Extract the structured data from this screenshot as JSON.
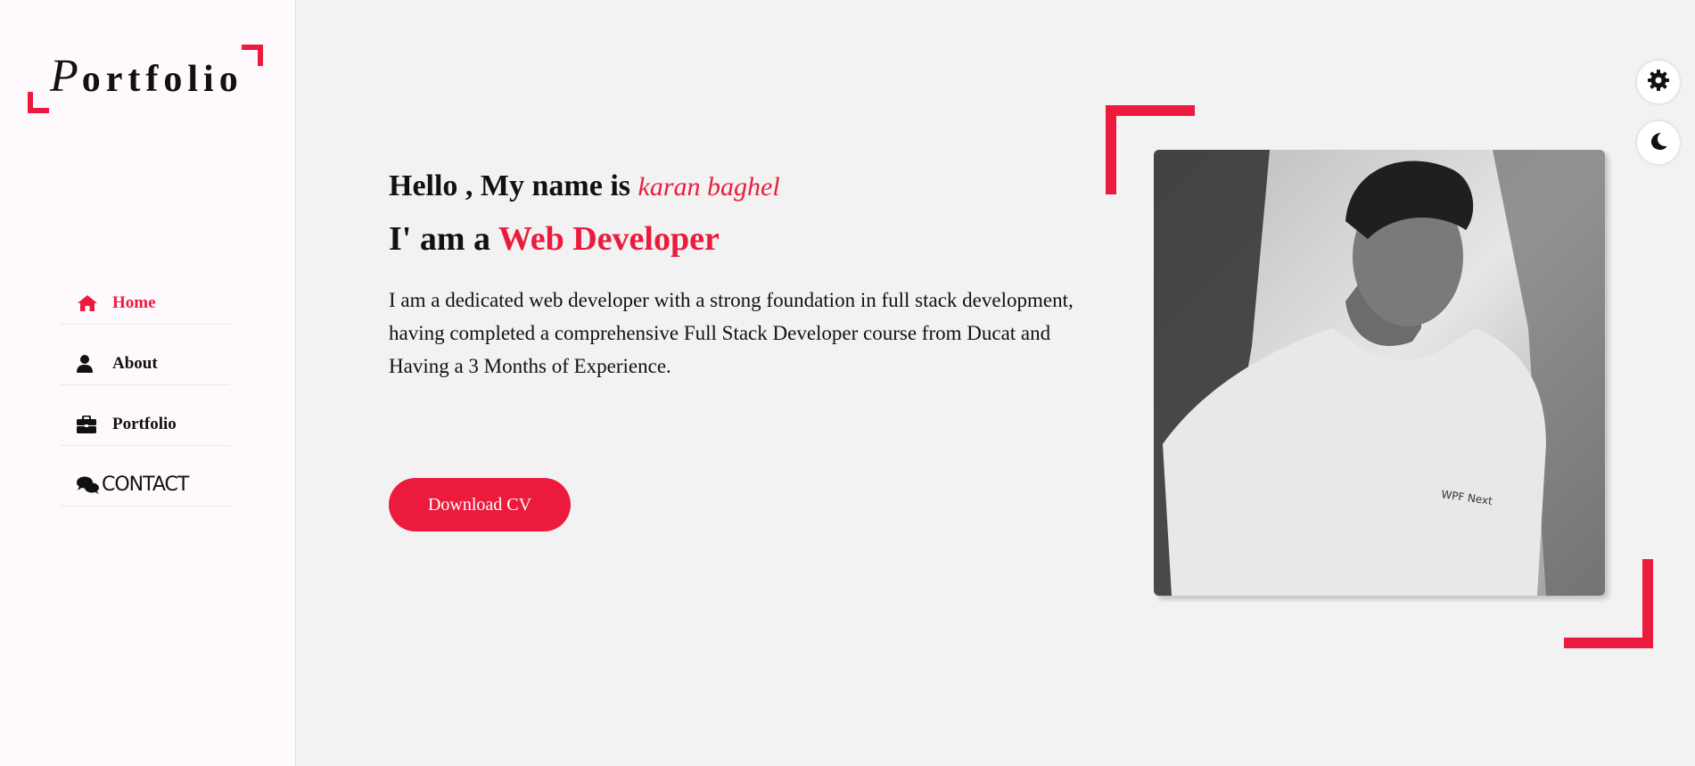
{
  "logo": {
    "text_first": "P",
    "text_rest": "ortfolio"
  },
  "nav": {
    "items": [
      {
        "label": "Home",
        "icon": "home-icon",
        "active": true
      },
      {
        "label": "About",
        "icon": "user-icon",
        "active": false
      },
      {
        "label": "Portfolio",
        "icon": "briefcase-icon",
        "active": false
      },
      {
        "label": "CONTACT",
        "icon": "comments-icon",
        "active": false
      }
    ]
  },
  "hero": {
    "greeting": "Hello , My name is",
    "name": "karan baghel",
    "role_prefix": "I' am a",
    "role": "Web Developer",
    "description": "I am a dedicated web developer with a strong foundation in full stack development, having completed a comprehensive Full Stack Developer course from Ducat and Having a 3 Months of Experience.",
    "cv_button": "Download CV"
  },
  "photo": {
    "shirt_text": "WPF Next"
  },
  "controls": {
    "settings_icon": "gear-icon",
    "theme_icon": "moon-icon"
  },
  "colors": {
    "accent": "#ec1b3d",
    "sidebar_bg": "#fdf9fd",
    "main_bg": "#f2f2f2"
  }
}
